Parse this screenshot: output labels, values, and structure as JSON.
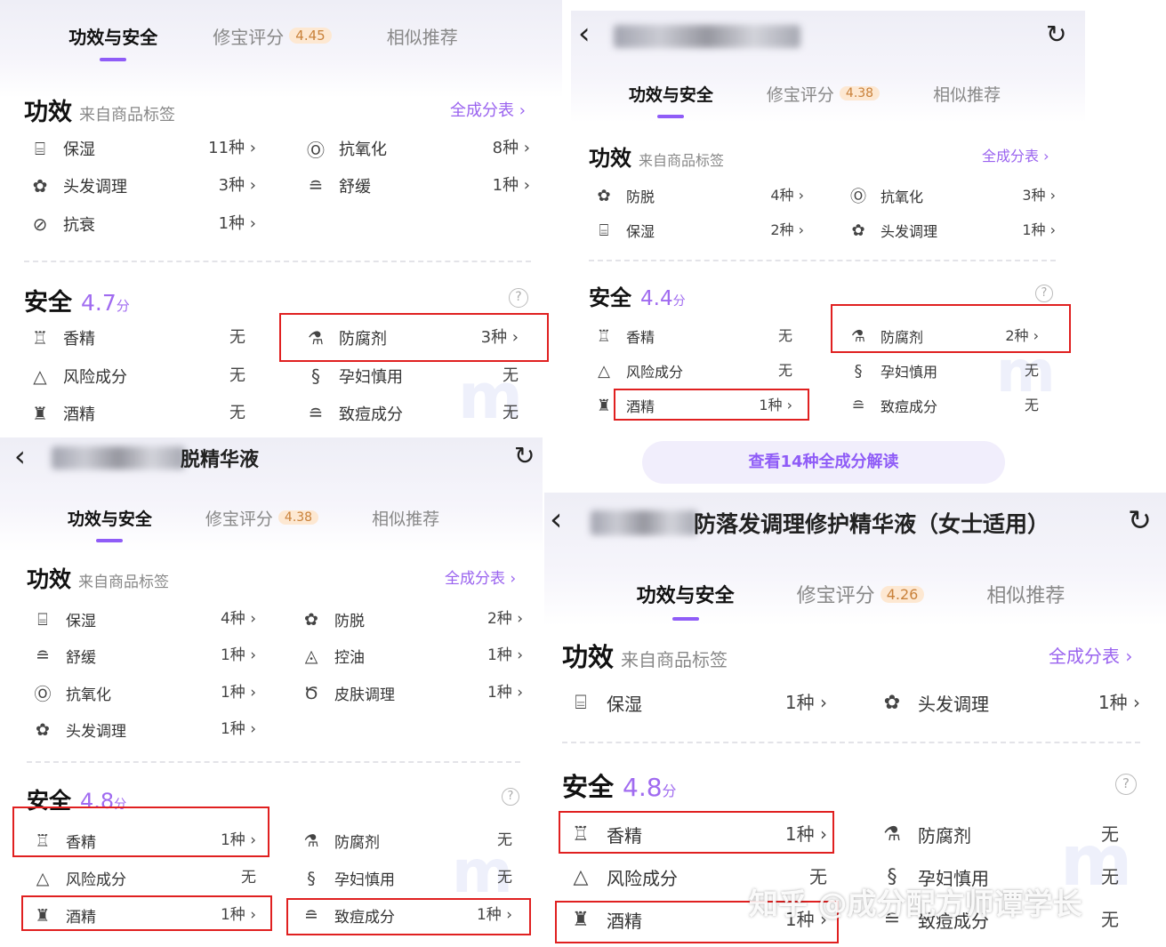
{
  "tabs": {
    "effect": "功效与安全",
    "score": "修宝评分",
    "similar": "相似推荐"
  },
  "section": {
    "effect": "功效",
    "effect_sub": "来自商品标签",
    "all_ingredients": "全成分表 ›",
    "safety": "安全",
    "unit": "分",
    "help": "?"
  },
  "panel1": {
    "score": "4.45",
    "effects": [
      {
        "icon": "moisture-icon",
        "glyph": "⌸",
        "label": "保湿",
        "value": "11种 ›"
      },
      {
        "icon": "antioxidant-icon",
        "glyph": "Ⓞ",
        "label": "抗氧化",
        "value": "8种 ›"
      },
      {
        "icon": "hair-care-icon",
        "glyph": "✿",
        "label": "头发调理",
        "value": "3种 ›"
      },
      {
        "icon": "soothing-icon",
        "glyph": "≘",
        "label": "舒缓",
        "value": "1种 ›"
      },
      {
        "icon": "anti-aging-icon",
        "glyph": "⊘",
        "label": "抗衰",
        "value": "1种 ›"
      }
    ],
    "safety_score": "4.7",
    "safety": [
      {
        "icon": "fragrance-icon",
        "glyph": "♖",
        "label": "香精",
        "value": "无"
      },
      {
        "icon": "preservative-icon",
        "glyph": "⚗",
        "label": "防腐剂",
        "value": "3种 ›"
      },
      {
        "icon": "risk-icon",
        "glyph": "△",
        "label": "风险成分",
        "value": "无"
      },
      {
        "icon": "pregnancy-icon",
        "glyph": "§",
        "label": "孕妇慎用",
        "value": "无"
      },
      {
        "icon": "alcohol-icon",
        "glyph": "♜",
        "label": "酒精",
        "value": "无"
      },
      {
        "icon": "acne-icon",
        "glyph": "≘",
        "label": "致痘成分",
        "value": "无"
      }
    ]
  },
  "panel2": {
    "back": "‹",
    "share": "↻",
    "score": "4.38",
    "effects": [
      {
        "icon": "anti-hairloss-icon",
        "glyph": "✿",
        "label": "防脱",
        "value": "4种 ›"
      },
      {
        "icon": "antioxidant-icon",
        "glyph": "Ⓞ",
        "label": "抗氧化",
        "value": "3种 ›"
      },
      {
        "icon": "moisture-icon",
        "glyph": "⌸",
        "label": "保湿",
        "value": "2种 ›"
      },
      {
        "icon": "hair-care-icon",
        "glyph": "✿",
        "label": "头发调理",
        "value": "1种 ›"
      }
    ],
    "safety_score": "4.4",
    "safety": [
      {
        "icon": "fragrance-icon",
        "glyph": "♖",
        "label": "香精",
        "value": "无"
      },
      {
        "icon": "preservative-icon",
        "glyph": "⚗",
        "label": "防腐剂",
        "value": "2种 ›"
      },
      {
        "icon": "risk-icon",
        "glyph": "△",
        "label": "风险成分",
        "value": "无"
      },
      {
        "icon": "pregnancy-icon",
        "glyph": "§",
        "label": "孕妇慎用",
        "value": "无"
      },
      {
        "icon": "alcohol-icon",
        "glyph": "♜",
        "label": "酒精",
        "value": "1种 ›"
      },
      {
        "icon": "acne-icon",
        "glyph": "≘",
        "label": "致痘成分",
        "value": "无"
      }
    ],
    "button": "查看14种全成分解读"
  },
  "panel3": {
    "back": "‹",
    "title_visible": "脱精华液",
    "share": "↻",
    "score": "4.38",
    "effects": [
      {
        "icon": "moisture-icon",
        "glyph": "⌸",
        "label": "保湿",
        "value": "4种 ›"
      },
      {
        "icon": "anti-hairloss-icon",
        "glyph": "✿",
        "label": "防脱",
        "value": "2种 ›"
      },
      {
        "icon": "soothing-icon",
        "glyph": "≘",
        "label": "舒缓",
        "value": "1种 ›"
      },
      {
        "icon": "oil-control-icon",
        "glyph": "◬",
        "label": "控油",
        "value": "1种 ›"
      },
      {
        "icon": "antioxidant-icon",
        "glyph": "Ⓞ",
        "label": "抗氧化",
        "value": "1种 ›"
      },
      {
        "icon": "skin-care-icon",
        "glyph": "Ծ",
        "label": "皮肤调理",
        "value": "1种 ›"
      },
      {
        "icon": "hair-care-icon",
        "glyph": "✿",
        "label": "头发调理",
        "value": "1种 ›"
      }
    ],
    "safety_score": "4.8",
    "safety": [
      {
        "icon": "fragrance-icon",
        "glyph": "♖",
        "label": "香精",
        "value": "1种 ›"
      },
      {
        "icon": "preservative-icon",
        "glyph": "⚗",
        "label": "防腐剂",
        "value": "无"
      },
      {
        "icon": "risk-icon",
        "glyph": "△",
        "label": "风险成分",
        "value": "无"
      },
      {
        "icon": "pregnancy-icon",
        "glyph": "§",
        "label": "孕妇慎用",
        "value": "无"
      },
      {
        "icon": "alcohol-icon",
        "glyph": "♜",
        "label": "酒精",
        "value": "1种 ›"
      },
      {
        "icon": "acne-icon",
        "glyph": "≘",
        "label": "致痘成分",
        "value": "1种 ›"
      }
    ]
  },
  "panel4": {
    "back": "‹",
    "title_visible": "防落发调理修护精华液（女士适用）",
    "share": "↻",
    "score": "4.26",
    "effects": [
      {
        "icon": "moisture-icon",
        "glyph": "⌸",
        "label": "保湿",
        "value": "1种 ›"
      },
      {
        "icon": "hair-care-icon",
        "glyph": "✿",
        "label": "头发调理",
        "value": "1种 ›"
      }
    ],
    "safety_score": "4.8",
    "safety": [
      {
        "icon": "fragrance-icon",
        "glyph": "♖",
        "label": "香精",
        "value": "1种 ›"
      },
      {
        "icon": "preservative-icon",
        "glyph": "⚗",
        "label": "防腐剂",
        "value": "无"
      },
      {
        "icon": "risk-icon",
        "glyph": "△",
        "label": "风险成分",
        "value": "无"
      },
      {
        "icon": "pregnancy-icon",
        "glyph": "§",
        "label": "孕妇慎用",
        "value": "无"
      },
      {
        "icon": "alcohol-icon",
        "glyph": "♜",
        "label": "酒精",
        "value": "1种 ›"
      },
      {
        "icon": "acne-icon",
        "glyph": "≘",
        "label": "致痘成分",
        "value": "无"
      }
    ]
  },
  "watermark": "知乎 @成分配方师谭学长"
}
